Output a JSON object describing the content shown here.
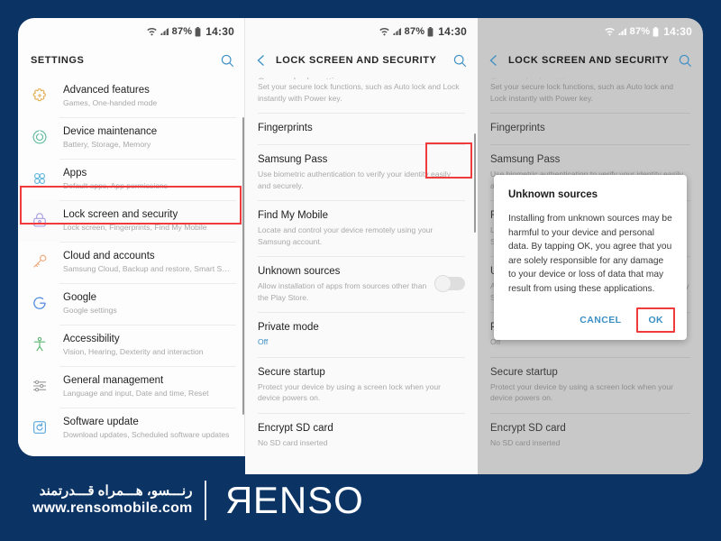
{
  "status_bar": {
    "battery": "87%",
    "time": "14:30"
  },
  "panel1": {
    "title": "SETTINGS",
    "search_icon": "search-icon",
    "items": [
      {
        "icon": "puzzle-gear-icon",
        "title": "Advanced features",
        "subtitle": "Games, One-handed mode"
      },
      {
        "icon": "device-maintenance-icon",
        "title": "Device maintenance",
        "subtitle": "Battery, Storage, Memory"
      },
      {
        "icon": "apps-grid-icon",
        "title": "Apps",
        "subtitle": "Default apps, App permissions"
      },
      {
        "icon": "lock-icon",
        "title": "Lock screen and security",
        "subtitle": "Lock screen, Fingerprints, Find My Mobile"
      },
      {
        "icon": "key-icon",
        "title": "Cloud and accounts",
        "subtitle": "Samsung Cloud, Backup and restore, Smart Swit..."
      },
      {
        "icon": "google-icon",
        "title": "Google",
        "subtitle": "Google settings"
      },
      {
        "icon": "accessibility-icon",
        "title": "Accessibility",
        "subtitle": "Vision, Hearing, Dexterity and interaction"
      },
      {
        "icon": "sliders-icon",
        "title": "General management",
        "subtitle": "Language and input, Date and time, Reset"
      },
      {
        "icon": "software-update-icon",
        "title": "Software update",
        "subtitle": "Download updates, Scheduled software updates"
      }
    ],
    "highlighted_item_index": 3
  },
  "panel2": {
    "title": "LOCK SCREEN AND SECURITY",
    "back_icon": "chevron-left-icon",
    "search_icon": "search-icon",
    "items": [
      {
        "title": "Secure lock settings",
        "desc": "Set your secure lock functions, such as Auto lock and Lock instantly with Power key.",
        "clipped": true
      },
      {
        "title": "Fingerprints",
        "desc": ""
      },
      {
        "title": "Samsung Pass",
        "desc": "Use biometric authentication to verify your identity easily and securely."
      },
      {
        "title": "Find My Mobile",
        "desc": "Locate and control your device remotely using your Samsung account."
      },
      {
        "title": "Unknown sources",
        "desc": "Allow installation of apps from sources other than the Play Store.",
        "toggle": "off"
      },
      {
        "title": "Private mode",
        "desc": "Off",
        "desc_blue": true
      },
      {
        "title": "Secure startup",
        "desc": "Protect your device by using a screen lock when your device powers on."
      },
      {
        "title": "Encrypt SD card",
        "desc": "No SD card inserted"
      }
    ],
    "highlighted_item_index": 4
  },
  "panel3": {
    "title": "LOCK SCREEN AND SECURITY",
    "back_icon": "chevron-left-icon",
    "search_icon": "search-icon",
    "items": [
      {
        "title": "Secure lock settings",
        "desc": "Set your secure lock functions, such as Auto lock and Lock instantly with Power key.",
        "clipped": true
      },
      {
        "title": "Fingerprints",
        "desc": ""
      },
      {
        "title": "Samsung Pass",
        "desc": "Use biometric authentication to verify your identity easily and securely."
      },
      {
        "title": "Find My Mobile",
        "desc": "Locate and control your device remotely using your Samsung account."
      },
      {
        "title": "Unknown sources",
        "desc": "Allow installation of apps from sources other than the Play Store."
      },
      {
        "title": "Private mode",
        "desc": "Off",
        "desc_blue": true
      },
      {
        "title": "Secure startup",
        "desc": "Protect your device by using a screen lock when your device powers on."
      },
      {
        "title": "Encrypt SD card",
        "desc": "No SD card inserted"
      }
    ],
    "dialog": {
      "title": "Unknown sources",
      "body": "Installing from unknown sources may be harmful to your device and personal data. By tapping OK, you agree that you are solely responsible for any damage to your device or loss of data that may result from using these applications.",
      "cancel_label": "CANCEL",
      "ok_label": "OK"
    }
  },
  "footer": {
    "tagline_fa": "رنـــسو، هـــمراه قـــدرتمند",
    "url": "www.rensomobile.com",
    "logo_first": "R",
    "logo_rest": "ENSO"
  },
  "colors": {
    "brand_navy": "#0b3364",
    "accent_blue": "#3b8fc4",
    "highlight_red": "#ef3b3b"
  }
}
